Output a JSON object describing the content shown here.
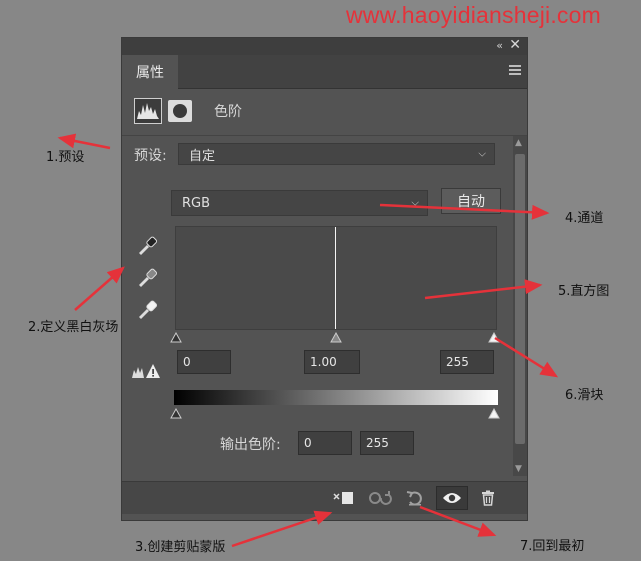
{
  "watermark": "www.haoyidiansheji.com",
  "panel": {
    "tab_label": "属性",
    "adjustment_title": "色阶",
    "preset_label": "预设:",
    "preset_value": "自定",
    "channel_value": "RGB",
    "auto_button": "自动",
    "input_levels": {
      "black": "0",
      "gamma": "1.00",
      "white": "255"
    },
    "output_label": "输出色阶:",
    "output_levels": {
      "black": "0",
      "white": "255"
    },
    "icons": {
      "collapse": "double-chevron-left-icon",
      "close": "close-icon",
      "menu": "hamburger-menu-icon",
      "levels": "levels-histogram-icon",
      "mask": "layer-mask-icon",
      "eyedropper_black": "eyedropper-black-icon",
      "eyedropper_gray": "eyedropper-gray-icon",
      "eyedropper_white": "eyedropper-white-icon",
      "warning": "histogram-warning-icon",
      "clip": "clip-to-layer-icon",
      "view_previous": "view-previous-state-icon",
      "reset": "reset-icon",
      "visibility": "eye-icon",
      "delete": "trash-icon"
    }
  },
  "annotations": {
    "preset": "1.预设",
    "eyedroppers": "2.定义黑白灰场",
    "clip": "3.创建剪贴蒙版",
    "channel": "4.通道",
    "histogram": "5.直方图",
    "slider": "6.滑块",
    "reset": "7.回到最初"
  },
  "colors": {
    "annotation_arrow": "#e5323a",
    "watermark": "#e5323a",
    "panel_bg": "#535353"
  }
}
